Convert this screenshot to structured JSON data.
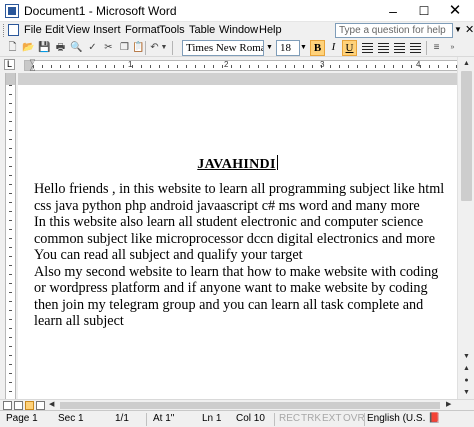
{
  "window": {
    "title": "Document1 - Microsoft Word",
    "minimize": "–",
    "maximize": "☐",
    "close": "✕"
  },
  "menu": {
    "items": [
      "File",
      "Edit",
      "View",
      "Insert",
      "Format",
      "Tools",
      "Table",
      "Window",
      "Help"
    ],
    "help_placeholder": "Type a question for help",
    "doc_close": "✕"
  },
  "toolbar": {
    "font_name": "Times New Roman",
    "font_size": "18",
    "bold": "B",
    "italic": "I",
    "underline": "U",
    "bold_active": true,
    "underline_active": true
  },
  "ruler": {
    "numbers": [
      "1",
      "2",
      "3",
      "4"
    ]
  },
  "document": {
    "title": "JAVAHINDI",
    "paragraphs": [
      "Hello friends , in this website to learn all programming subject like html css java python php android javaascript c# ms word and many more",
      "In this website also learn all student electronic and computer science common subject like microprocessor dccn digital electronics and more",
      "You can read all subject and qualify your target",
      "Also my second website to learn that how to make website with coding or wordpress platform and if anyone want to make website by coding then join my telegram group and you can learn all task complete and learn all subject"
    ]
  },
  "status": {
    "page": "Page 1",
    "sec": "Sec 1",
    "pages": "1/1",
    "at": "At 1\"",
    "ln": "Ln 1",
    "col": "Col 10",
    "rec": "REC",
    "trk": "TRK",
    "ext": "EXT",
    "ovr": "OVR",
    "language": "English (U.S."
  },
  "icons": {
    "new": "new-document-icon",
    "open": "open-folder-icon",
    "save": "save-icon",
    "undo": "undo-icon",
    "spelling": "spelling-check-icon"
  }
}
